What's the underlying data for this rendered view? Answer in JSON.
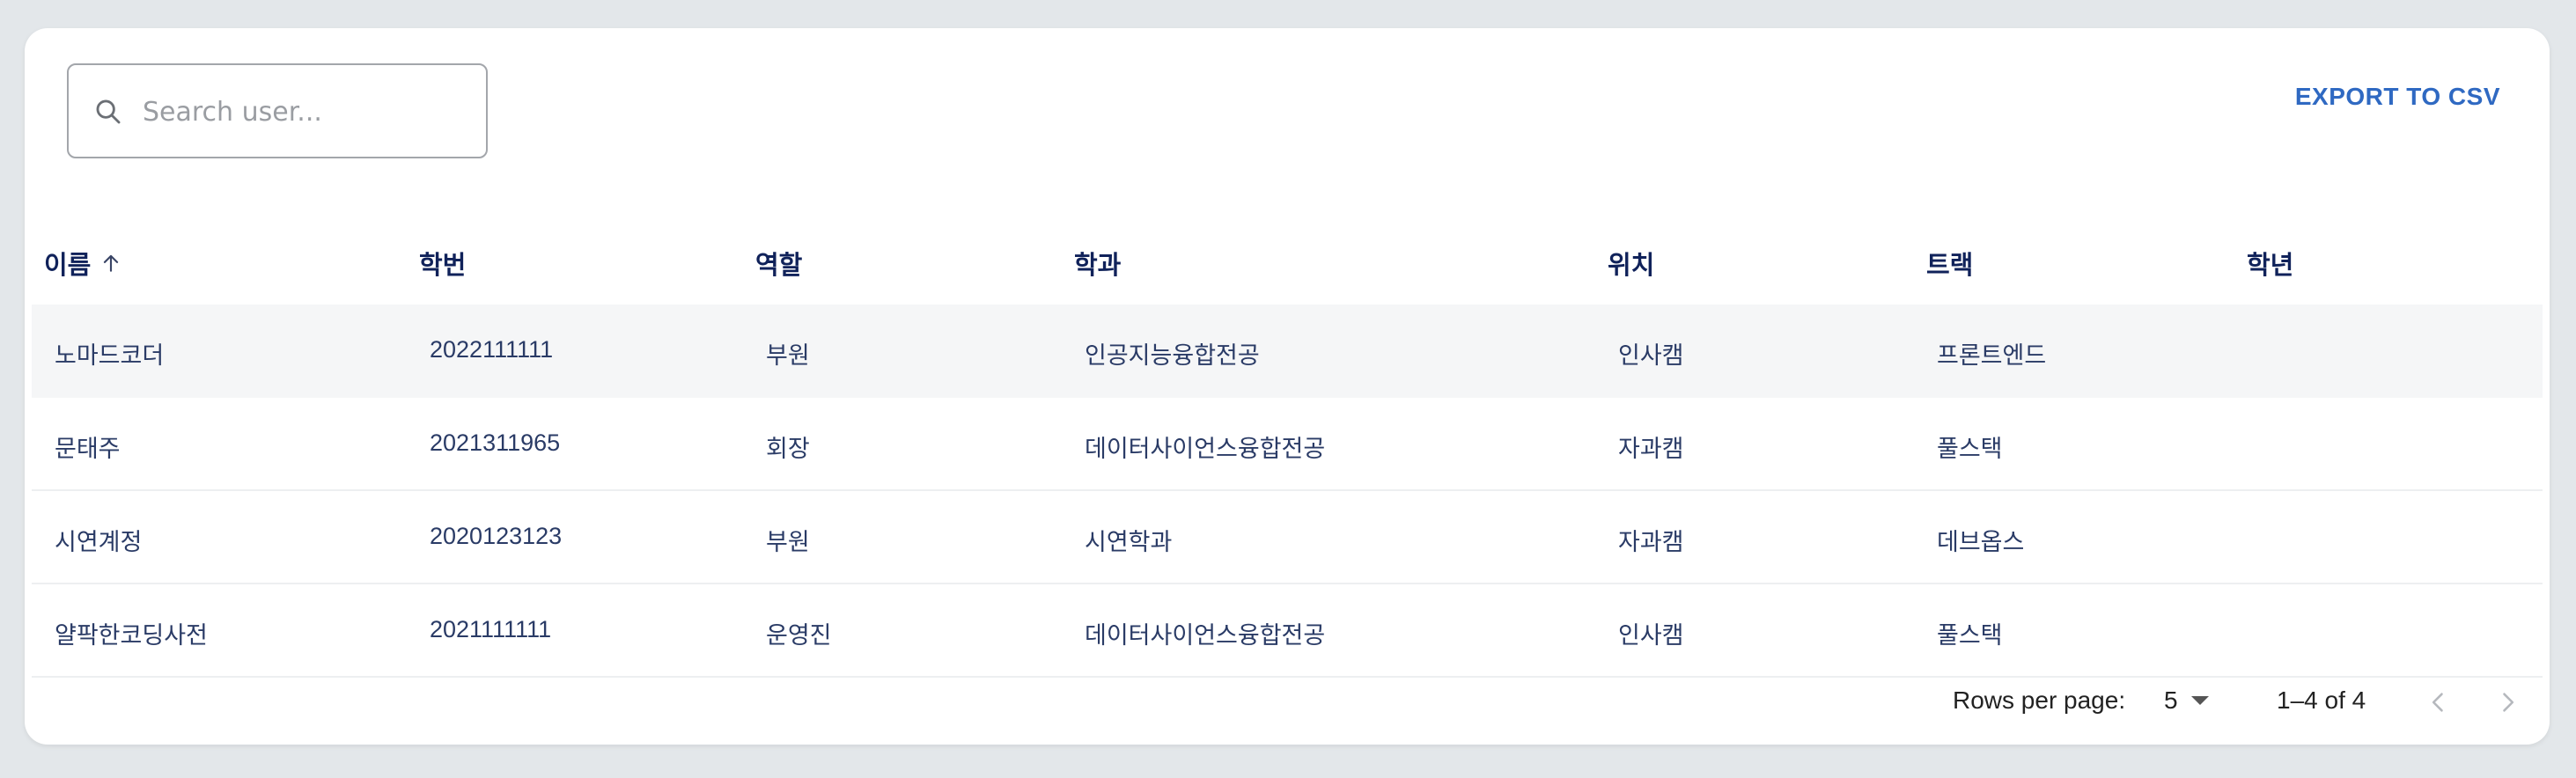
{
  "toolbar": {
    "search_placeholder": "Search user...",
    "search_icon": "search-icon",
    "export_label": "EXPORT TO CSV"
  },
  "table": {
    "columns": [
      {
        "label": "이름",
        "sorted": "asc"
      },
      {
        "label": "학번"
      },
      {
        "label": "역할"
      },
      {
        "label": "학과"
      },
      {
        "label": "위치"
      },
      {
        "label": "트랙"
      },
      {
        "label": "학년"
      }
    ],
    "rows": [
      {
        "name": "노마드코더",
        "student_id": "2022111111",
        "role": "부원",
        "department": "인공지능융합전공",
        "location": "인사캠",
        "track": "프론트엔드",
        "grade": ""
      },
      {
        "name": "문태주",
        "student_id": "2021311965",
        "role": "회장",
        "department": "데이터사이언스융합전공",
        "location": "자과캠",
        "track": "풀스택",
        "grade": ""
      },
      {
        "name": "시연계정",
        "student_id": "2020123123",
        "role": "부원",
        "department": "시연학과",
        "location": "자과캠",
        "track": "데브옵스",
        "grade": ""
      },
      {
        "name": "얄팍한코딩사전",
        "student_id": "2021111111",
        "role": "운영진",
        "department": "데이터사이언스융합전공",
        "location": "인사캠",
        "track": "풀스택",
        "grade": ""
      }
    ]
  },
  "pagination": {
    "rows_per_page_label": "Rows per page:",
    "rows_per_page_value": "5",
    "range_label": "1–4 of 4"
  },
  "colors": {
    "accent": "#2f69c2",
    "header_text": "#10225a",
    "cell_text": "#2a3b66",
    "background": "#e3e7ea",
    "highlight_row": "#f5f6f7"
  }
}
